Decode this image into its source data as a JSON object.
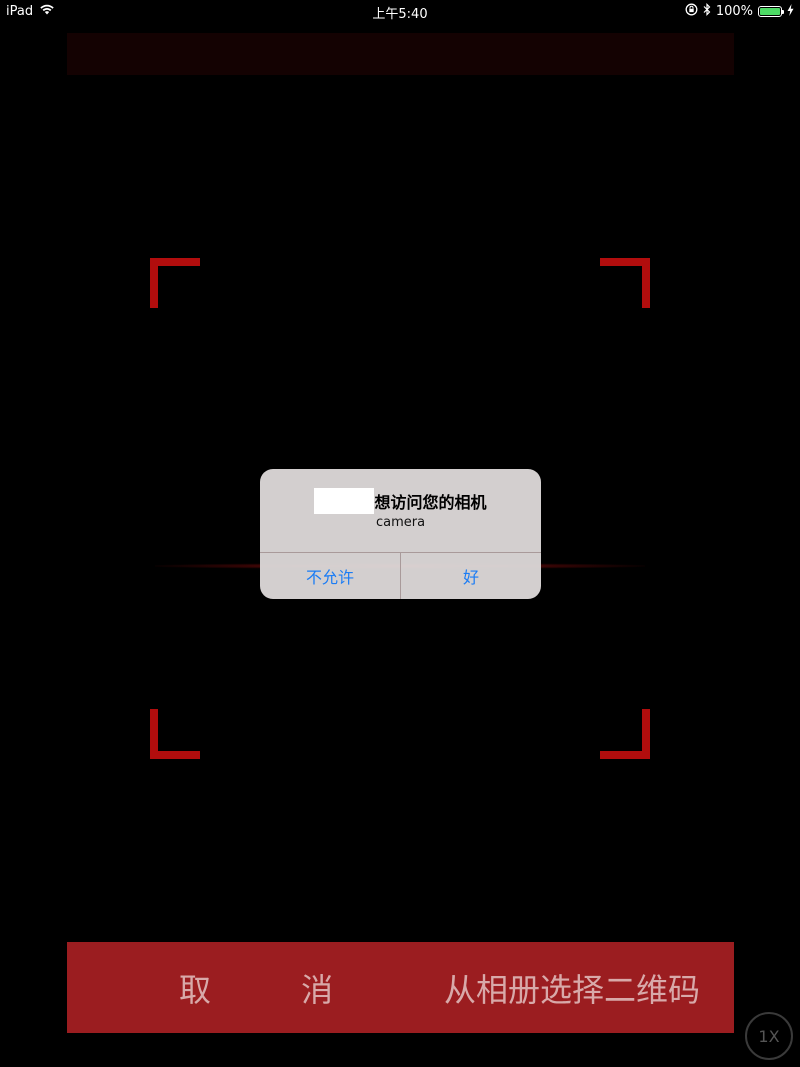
{
  "status_bar": {
    "device": "iPad",
    "time": "上午5:40",
    "battery_percent": "100%",
    "wifi_icon": "wifi-icon",
    "lock_icon": "rotation-lock-icon",
    "bluetooth_icon": "bluetooth-icon",
    "charging_icon": "charging-bolt-icon"
  },
  "scanner": {
    "corner_color": "#b10d0d"
  },
  "alert": {
    "title": "想访问您的相机",
    "message": "camera",
    "deny_label": "不允许",
    "allow_label": "好"
  },
  "bottom_bar": {
    "cancel_label": "取 消",
    "album_label": "从相册选择二维码",
    "background": "#9b1d20"
  },
  "zoom": {
    "label": "1X"
  }
}
